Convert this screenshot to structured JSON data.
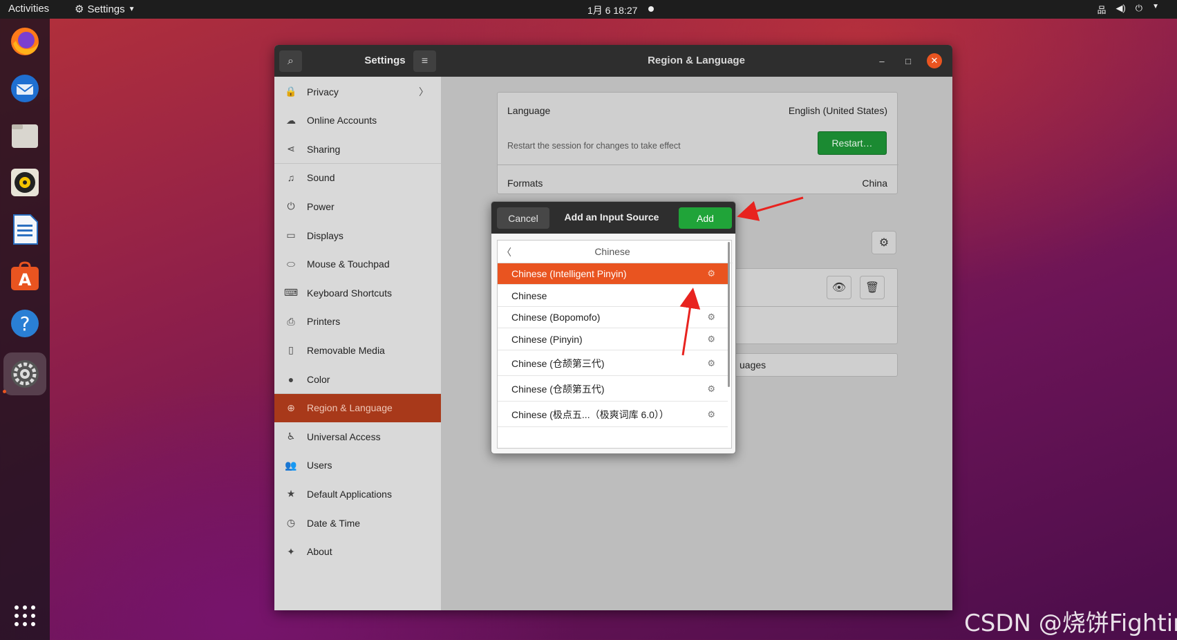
{
  "topbar": {
    "activities": "Activities",
    "app_menu": "Settings",
    "clock": "1月 6  18:27"
  },
  "dock": {
    "items": [
      "firefox-icon",
      "thunderbird-icon",
      "files-icon",
      "rhythmbox-icon",
      "libreoffice-writer-icon",
      "software-icon",
      "help-icon",
      "settings-icon"
    ],
    "show_apps": "grid-icon"
  },
  "settings": {
    "sidebar_title": "Settings",
    "window_title": "Region & Language",
    "sidebar": {
      "items": [
        {
          "label": "Privacy",
          "icon": "lock-icon"
        },
        {
          "label": "Online Accounts",
          "icon": "cloud-icon"
        },
        {
          "label": "Sharing",
          "icon": "share-icon"
        },
        {
          "label": "Sound",
          "icon": "music-note-icon"
        },
        {
          "label": "Power",
          "icon": "power-icon"
        },
        {
          "label": "Displays",
          "icon": "display-icon"
        },
        {
          "label": "Mouse & Touchpad",
          "icon": "mouse-icon"
        },
        {
          "label": "Keyboard Shortcuts",
          "icon": "keyboard-icon"
        },
        {
          "label": "Printers",
          "icon": "printer-icon"
        },
        {
          "label": "Removable Media",
          "icon": "usb-icon"
        },
        {
          "label": "Color",
          "icon": "color-icon"
        },
        {
          "label": "Region & Language",
          "icon": "globe-icon",
          "selected": true
        },
        {
          "label": "Universal Access",
          "icon": "accessibility-icon"
        },
        {
          "label": "Users",
          "icon": "users-icon"
        },
        {
          "label": "Default Applications",
          "icon": "star-icon"
        },
        {
          "label": "Date & Time",
          "icon": "clock-icon"
        },
        {
          "label": "About",
          "icon": "sparkle-icon"
        }
      ]
    },
    "main": {
      "language_label": "Language",
      "language_value": "English (United States)",
      "restart_note": "Restart the session for changes to take effect",
      "restart_button": "Restart…",
      "formats_label": "Formats",
      "formats_value": "China",
      "manage_languages_partial": "uages"
    }
  },
  "dialog": {
    "cancel": "Cancel",
    "title": "Add an Input Source",
    "add": "Add",
    "back_label": "Chinese",
    "rows": [
      {
        "label": "Chinese (Intelligent Pinyin)",
        "gear": true,
        "selected": true
      },
      {
        "label": "Chinese",
        "gear": false
      },
      {
        "label": "Chinese (Bopomofo)",
        "gear": true
      },
      {
        "label": "Chinese (Pinyin)",
        "gear": true
      },
      {
        "label": "Chinese (仓颉第三代)",
        "gear": true
      },
      {
        "label": "Chinese (仓颉第五代)",
        "gear": true
      },
      {
        "label": "Chinese (极点五...（极爽词库 6.0））",
        "gear": true
      }
    ]
  },
  "watermark": "CSDN @烧饼Fighting",
  "colors": {
    "accent": "#e95420",
    "add_green": "#20a439",
    "sidebar_selected": "#a8391a",
    "annotation_red": "#e8231f"
  }
}
